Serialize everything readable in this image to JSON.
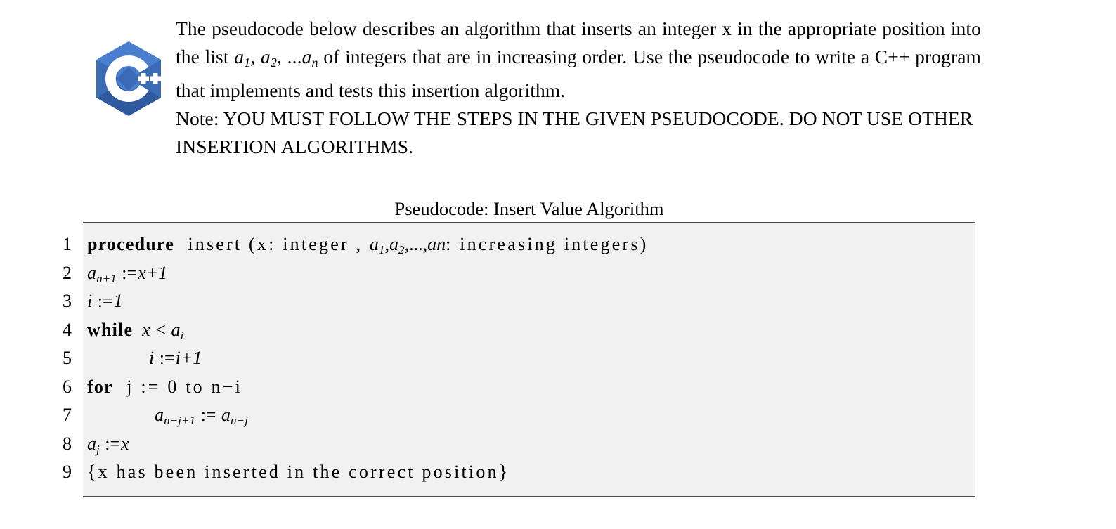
{
  "document": {
    "logo": {
      "name": "cpp-logo",
      "hex_outer_color": "#3b6bb5",
      "hex_light_color": "#4a7fd0",
      "hex_dark_color": "#2b5294",
      "glyph_color": "#ffffff",
      "alt": "C++ logo"
    },
    "prompt": {
      "paragraph_1_pre": "The pseudocode below describes an algorithm that inserts an integer x in the appropriate position into the list ",
      "list_a1": "a",
      "list_a1_sub": "1",
      "list_comma_1": ", ",
      "list_a2": "a",
      "list_a2_sub": "2",
      "list_ellipsis": ", ...",
      "list_an": "a",
      "list_an_sub": "n",
      "paragraph_1_post": " of integers that are in increasing order. Use the pseudocode to write a C++ program that implements and tests this insertion algorithm.",
      "paragraph_2": "Note: YOU MUST FOLLOW THE STEPS IN THE GIVEN PSEUDOCODE. DO NOT USE OTHER INSERTION ALGORITHMS."
    },
    "pseudocode": {
      "caption": "Pseudocode: Insert Value Algorithm",
      "background_color": "#f1f1f1",
      "rule_color": "#4a4a4a",
      "lines": [
        {
          "number": "1",
          "keyword": "procedure",
          "text_a": "insert (x: integer ,",
          "var_a": "a",
          "var_a_sub": "1",
          "sep_a": ",",
          "var_b": "a",
          "var_b_sub": "2",
          "sep_b": ",...,",
          "var_c": "an",
          "text_b": ": increasing integers)"
        },
        {
          "number": "2",
          "lhs": "a",
          "lhs_sub": "n+1",
          "assign": ":=",
          "rhs": "x+1"
        },
        {
          "number": "3",
          "lhs": "i",
          "assign": ":=",
          "rhs": "1"
        },
        {
          "number": "4",
          "keyword": "while",
          "expr_lhs": "x",
          "relop": "<",
          "expr_rhs": "a",
          "expr_rhs_sub": "i"
        },
        {
          "number": "5",
          "lhs": "i",
          "assign": ":=",
          "rhs": "i+1"
        },
        {
          "number": "6",
          "keyword": "for",
          "text": "j := 0 to n−i"
        },
        {
          "number": "7",
          "lhs": "a",
          "lhs_sub": "n−j+1",
          "assign": ":=",
          "rhs": "a",
          "rhs_sub": "n−j"
        },
        {
          "number": "8",
          "lhs": "a",
          "lhs_sub": "j",
          "assign": ":=",
          "rhs": "x"
        },
        {
          "number": "9",
          "text": "{x has been inserted in the correct position}"
        }
      ]
    }
  }
}
